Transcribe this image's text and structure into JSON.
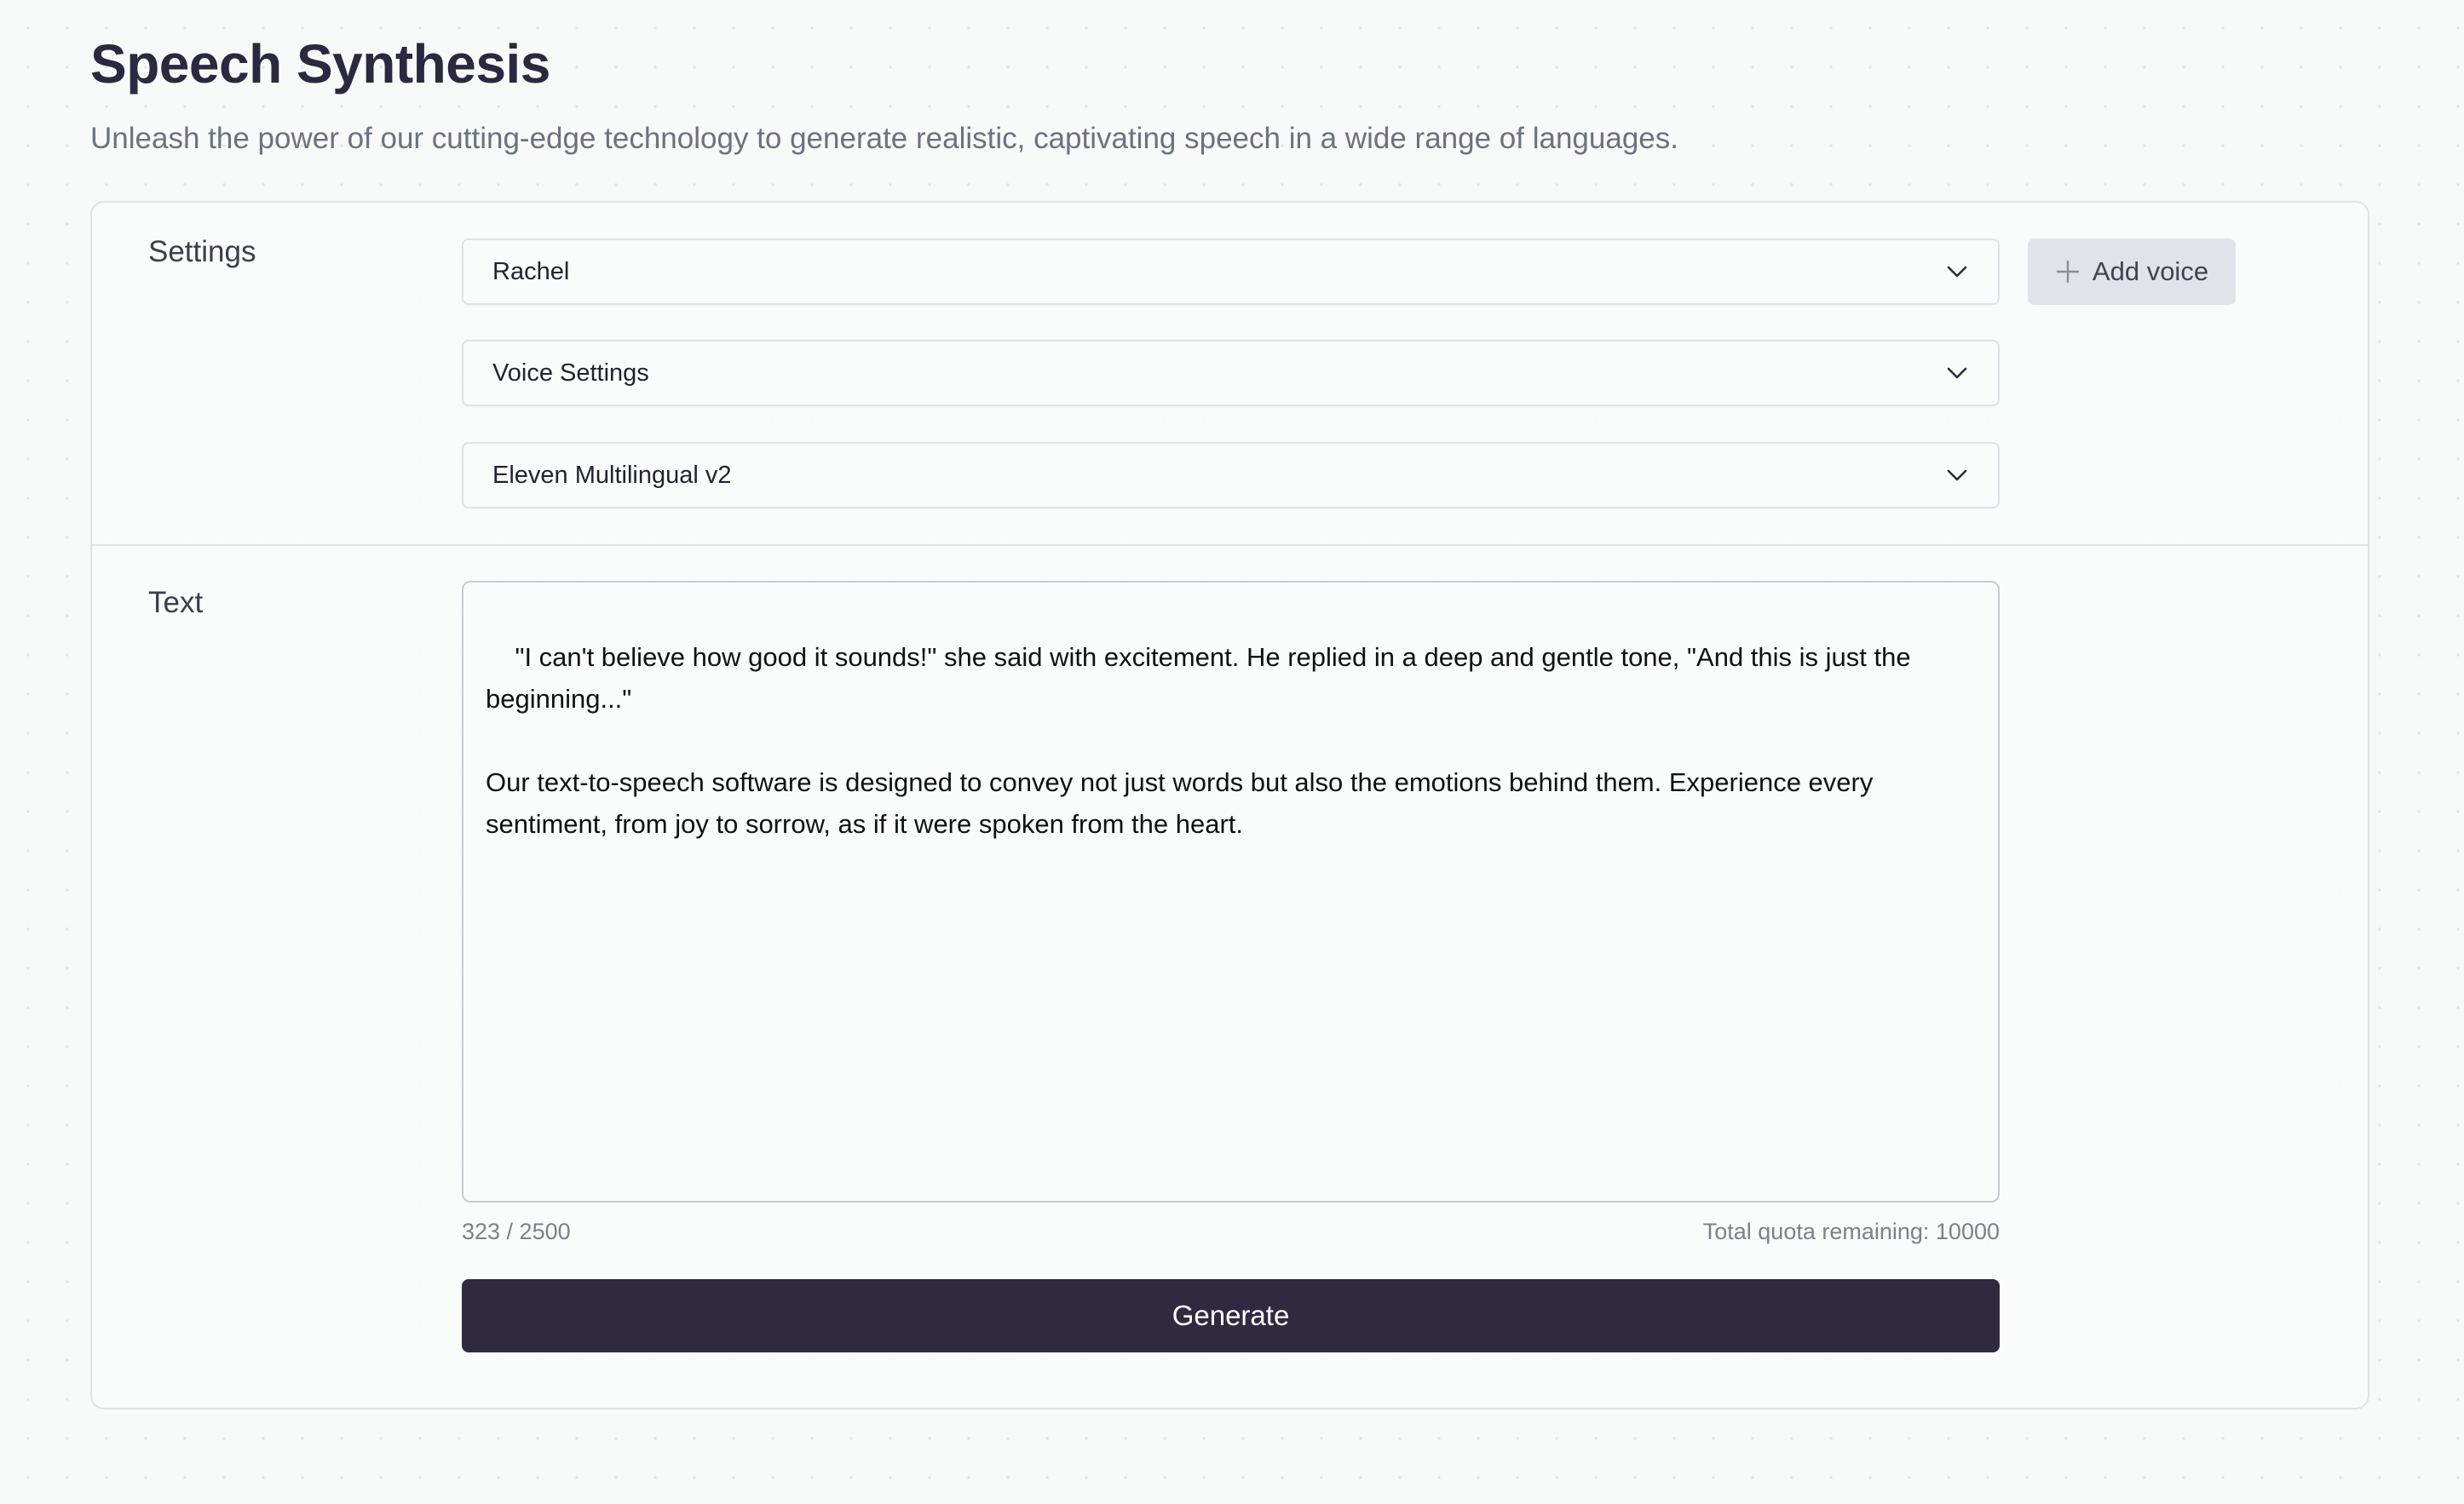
{
  "header": {
    "title": "Speech Synthesis",
    "subtitle": "Unleash the power of our cutting-edge technology to generate realistic, captivating speech in a wide range of languages."
  },
  "settings": {
    "label": "Settings",
    "voice_select": {
      "value": "Rachel",
      "icon": "chevron-down-icon"
    },
    "voice_settings_select": {
      "value": "Voice Settings",
      "icon": "chevron-down-icon"
    },
    "model_select": {
      "value": "Eleven Multilingual v2",
      "icon": "chevron-down-icon"
    },
    "add_voice_button": {
      "label": "Add voice",
      "icon": "plus-icon"
    }
  },
  "text_section": {
    "label": "Text",
    "textarea_value": "\"I can't believe how good it sounds!\" she said with excitement. He replied in a deep and gentle tone, \"And this is just the beginning...\"\n\nOur text-to-speech software is designed to convey not just words but also the emotions behind them. Experience every sentiment, from joy to sorrow, as if it were spoken from the heart.",
    "char_count": "323 / 2500",
    "quota_remaining": "Total quota remaining: 10000",
    "generate_button": "Generate"
  },
  "colors": {
    "page_background": "#f8f9f9",
    "title": "#2b2840",
    "primary_button": "#2f2a40",
    "secondary_button": "#e2e3e8",
    "muted_text": "#6b7280"
  }
}
